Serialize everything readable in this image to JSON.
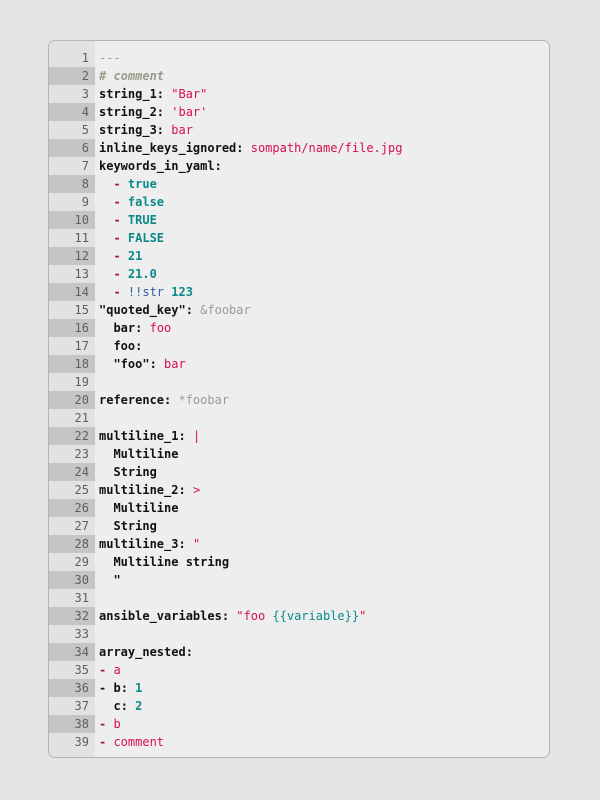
{
  "editor": {
    "language": "yaml",
    "colors": {
      "background": "#eeeeee",
      "gutter": "#e2e2e2",
      "gutter_alt": "#c5c5c5",
      "key": "#111111",
      "string": "#d6114d",
      "number": "#0a8a8a",
      "anchor": "#9a9a9a",
      "tag": "#2f5fa8"
    },
    "lines": [
      {
        "n": "1",
        "tokens": [
          {
            "t": "---",
            "c": "doc"
          }
        ]
      },
      {
        "n": "2",
        "tokens": [
          {
            "t": "# comment",
            "c": "comment"
          }
        ]
      },
      {
        "n": "3",
        "tokens": [
          {
            "t": "string_1",
            "c": "key"
          },
          {
            "t": ": ",
            "c": "punct"
          },
          {
            "t": "\"Bar\"",
            "c": "str"
          }
        ]
      },
      {
        "n": "4",
        "tokens": [
          {
            "t": "string_2",
            "c": "key"
          },
          {
            "t": ": ",
            "c": "punct"
          },
          {
            "t": "'bar'",
            "c": "str"
          }
        ]
      },
      {
        "n": "5",
        "tokens": [
          {
            "t": "string_3",
            "c": "key"
          },
          {
            "t": ": ",
            "c": "punct"
          },
          {
            "t": "bar",
            "c": "str"
          }
        ]
      },
      {
        "n": "6",
        "tokens": [
          {
            "t": "inline_keys_ignored",
            "c": "key"
          },
          {
            "t": ": ",
            "c": "punct"
          },
          {
            "t": "sompath/name/file.jpg",
            "c": "str"
          }
        ]
      },
      {
        "n": "7",
        "tokens": [
          {
            "t": "keywords_in_yaml",
            "c": "key"
          },
          {
            "t": ":",
            "c": "punct"
          }
        ]
      },
      {
        "n": "8",
        "tokens": [
          {
            "t": "  ",
            "c": "plain"
          },
          {
            "t": "- ",
            "c": "dash"
          },
          {
            "t": "true",
            "c": "bool"
          }
        ]
      },
      {
        "n": "9",
        "tokens": [
          {
            "t": "  ",
            "c": "plain"
          },
          {
            "t": "- ",
            "c": "dash"
          },
          {
            "t": "false",
            "c": "bool"
          }
        ]
      },
      {
        "n": "10",
        "tokens": [
          {
            "t": "  ",
            "c": "plain"
          },
          {
            "t": "- ",
            "c": "dash"
          },
          {
            "t": "TRUE",
            "c": "bool"
          }
        ]
      },
      {
        "n": "11",
        "tokens": [
          {
            "t": "  ",
            "c": "plain"
          },
          {
            "t": "- ",
            "c": "dash"
          },
          {
            "t": "FALSE",
            "c": "bool"
          }
        ]
      },
      {
        "n": "12",
        "tokens": [
          {
            "t": "  ",
            "c": "plain"
          },
          {
            "t": "- ",
            "c": "dash"
          },
          {
            "t": "21",
            "c": "num"
          }
        ]
      },
      {
        "n": "13",
        "tokens": [
          {
            "t": "  ",
            "c": "plain"
          },
          {
            "t": "- ",
            "c": "dash"
          },
          {
            "t": "21.0",
            "c": "num"
          }
        ]
      },
      {
        "n": "14",
        "tokens": [
          {
            "t": "  ",
            "c": "plain"
          },
          {
            "t": "- ",
            "c": "dash"
          },
          {
            "t": "!!str",
            "c": "tag"
          },
          {
            "t": " ",
            "c": "plain"
          },
          {
            "t": "123",
            "c": "num"
          }
        ]
      },
      {
        "n": "15",
        "tokens": [
          {
            "t": "\"quoted_key\"",
            "c": "key"
          },
          {
            "t": ": ",
            "c": "punct"
          },
          {
            "t": "&foobar",
            "c": "anchor"
          }
        ]
      },
      {
        "n": "16",
        "tokens": [
          {
            "t": "  ",
            "c": "plain"
          },
          {
            "t": "bar",
            "c": "key"
          },
          {
            "t": ": ",
            "c": "punct"
          },
          {
            "t": "foo",
            "c": "str"
          }
        ]
      },
      {
        "n": "17",
        "tokens": [
          {
            "t": "  ",
            "c": "plain"
          },
          {
            "t": "foo",
            "c": "key"
          },
          {
            "t": ":",
            "c": "punct"
          }
        ]
      },
      {
        "n": "18",
        "tokens": [
          {
            "t": "  ",
            "c": "plain"
          },
          {
            "t": "\"foo\"",
            "c": "key"
          },
          {
            "t": ": ",
            "c": "punct"
          },
          {
            "t": "bar",
            "c": "str"
          }
        ]
      },
      {
        "n": "19",
        "tokens": []
      },
      {
        "n": "20",
        "tokens": [
          {
            "t": "reference",
            "c": "key"
          },
          {
            "t": ": ",
            "c": "punct"
          },
          {
            "t": "*foobar",
            "c": "anchor"
          }
        ]
      },
      {
        "n": "21",
        "tokens": []
      },
      {
        "n": "22",
        "tokens": [
          {
            "t": "multiline_1",
            "c": "key"
          },
          {
            "t": ": ",
            "c": "punct"
          },
          {
            "t": "|",
            "c": "str"
          }
        ]
      },
      {
        "n": "23",
        "tokens": [
          {
            "t": "  Multiline",
            "c": "key"
          }
        ]
      },
      {
        "n": "24",
        "tokens": [
          {
            "t": "  String",
            "c": "key"
          }
        ]
      },
      {
        "n": "25",
        "tokens": [
          {
            "t": "multiline_2",
            "c": "key"
          },
          {
            "t": ": ",
            "c": "punct"
          },
          {
            "t": ">",
            "c": "str"
          }
        ]
      },
      {
        "n": "26",
        "tokens": [
          {
            "t": "  Multiline",
            "c": "key"
          }
        ]
      },
      {
        "n": "27",
        "tokens": [
          {
            "t": "  String",
            "c": "key"
          }
        ]
      },
      {
        "n": "28",
        "tokens": [
          {
            "t": "multiline_3",
            "c": "key"
          },
          {
            "t": ": ",
            "c": "punct"
          },
          {
            "t": "\"",
            "c": "str"
          }
        ]
      },
      {
        "n": "29",
        "tokens": [
          {
            "t": "  Multiline string",
            "c": "key"
          }
        ]
      },
      {
        "n": "30",
        "tokens": [
          {
            "t": "  \"",
            "c": "key"
          }
        ]
      },
      {
        "n": "31",
        "tokens": []
      },
      {
        "n": "32",
        "tokens": [
          {
            "t": "ansible_variables",
            "c": "key"
          },
          {
            "t": ": ",
            "c": "punct"
          },
          {
            "t": "\"foo ",
            "c": "str"
          },
          {
            "t": "{{variable}}",
            "c": "interp"
          },
          {
            "t": "\"",
            "c": "str"
          }
        ]
      },
      {
        "n": "33",
        "tokens": []
      },
      {
        "n": "34",
        "tokens": [
          {
            "t": "array_nested",
            "c": "key"
          },
          {
            "t": ":",
            "c": "punct"
          }
        ]
      },
      {
        "n": "35",
        "tokens": [
          {
            "t": "- ",
            "c": "dash"
          },
          {
            "t": "a",
            "c": "str"
          }
        ]
      },
      {
        "n": "36",
        "tokens": [
          {
            "t": "- ",
            "c": "punct"
          },
          {
            "t": "b",
            "c": "key"
          },
          {
            "t": ": ",
            "c": "punct"
          },
          {
            "t": "1",
            "c": "num"
          }
        ]
      },
      {
        "n": "37",
        "tokens": [
          {
            "t": "  ",
            "c": "plain"
          },
          {
            "t": "c",
            "c": "key"
          },
          {
            "t": ": ",
            "c": "punct"
          },
          {
            "t": "2",
            "c": "num"
          }
        ]
      },
      {
        "n": "38",
        "tokens": [
          {
            "t": "- ",
            "c": "dash"
          },
          {
            "t": "b",
            "c": "str"
          }
        ]
      },
      {
        "n": "39",
        "tokens": [
          {
            "t": "- ",
            "c": "dash"
          },
          {
            "t": "comment",
            "c": "str"
          }
        ]
      }
    ]
  }
}
